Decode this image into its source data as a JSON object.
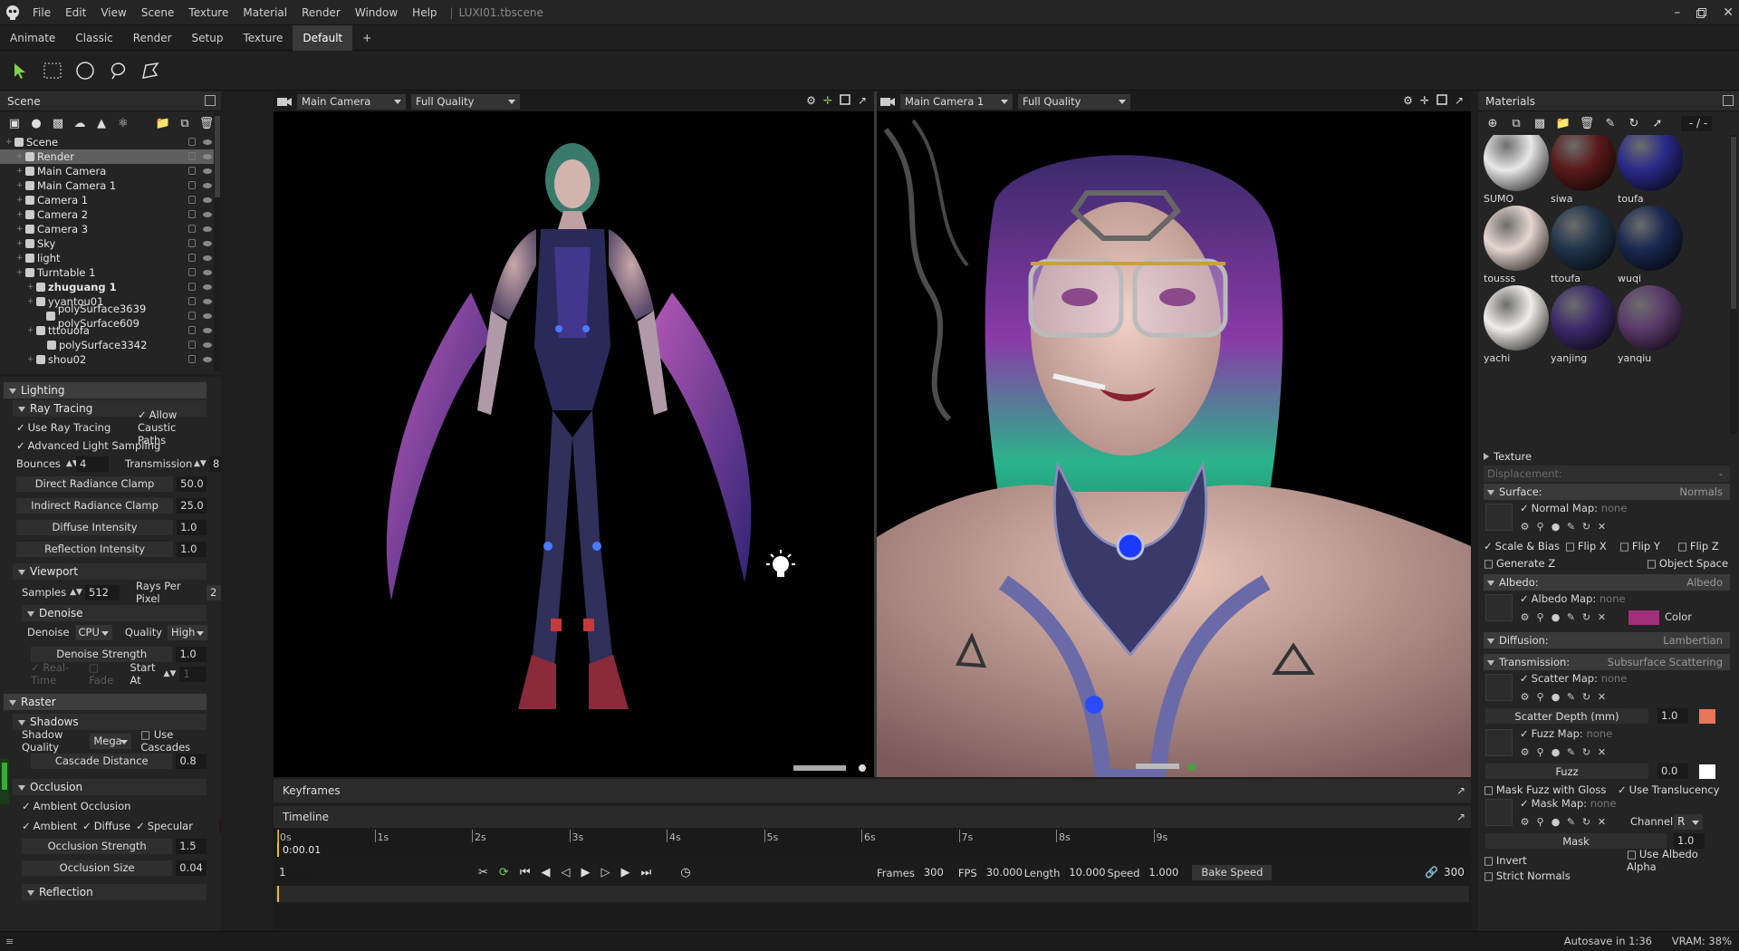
{
  "app": {
    "menu": [
      "File",
      "Edit",
      "View",
      "Scene",
      "Texture",
      "Material",
      "Render",
      "Window",
      "Help"
    ],
    "filename": "LUXI01.tbscene"
  },
  "workspace_tabs": [
    "Animate",
    "Classic",
    "Render",
    "Setup",
    "Texture",
    "Default",
    "+"
  ],
  "active_workspace": "Default",
  "scene": {
    "title": "Scene",
    "tree": [
      {
        "label": "Scene",
        "indent": 0
      },
      {
        "label": "Render",
        "indent": 1,
        "selected": true
      },
      {
        "label": "Main Camera",
        "indent": 1
      },
      {
        "label": "Main Camera 1",
        "indent": 1
      },
      {
        "label": "Camera 1",
        "indent": 1
      },
      {
        "label": "Camera 2",
        "indent": 1
      },
      {
        "label": "Camera 3",
        "indent": 1
      },
      {
        "label": "Sky",
        "indent": 1
      },
      {
        "label": "light",
        "indent": 1
      },
      {
        "label": "Turntable 1",
        "indent": 1
      },
      {
        "label": "zhuguang 1",
        "indent": 2,
        "bold": true
      },
      {
        "label": "yyantou01",
        "indent": 2
      },
      {
        "label": "polySurface3639 polySurface609",
        "indent": 3
      },
      {
        "label": "tttouofa",
        "indent": 2
      },
      {
        "label": "polySurface3342",
        "indent": 3
      },
      {
        "label": "shou02",
        "indent": 2
      }
    ]
  },
  "props": {
    "lighting": "Lighting",
    "ray_tracing": "Ray Tracing",
    "use_ray_tracing": "Use Ray Tracing",
    "allow_caustic": "Allow Caustic Paths",
    "adv_light": "Advanced Light Sampling",
    "bounces_label": "Bounces",
    "bounces": "4",
    "transmission_label": "Transmission",
    "transmission": "8",
    "direct_clamp": "Direct Radiance Clamp",
    "direct_clamp_val": "50.0",
    "indirect_clamp": "Indirect Radiance Clamp",
    "indirect_clamp_val": "25.0",
    "diffuse_int": "Diffuse Intensity",
    "diffuse_int_val": "1.0",
    "reflection_int": "Reflection Intensity",
    "reflection_int_val": "1.0",
    "viewport": "Viewport",
    "samples_label": "Samples",
    "samples": "512",
    "rays_label": "Rays Per Pixel",
    "rays": "2",
    "denoise_sec": "Denoise",
    "denoise_label": "Denoise",
    "denoise_dev": "CPU",
    "quality_label": "Quality",
    "quality": "High",
    "denoise_strength": "Denoise Strength",
    "denoise_strength_val": "1.0",
    "realtime": "Real-Time",
    "fade": "Fade",
    "start_at": "Start At",
    "start_at_val": "1",
    "raster": "Raster",
    "shadows": "Shadows",
    "shadow_quality_label": "Shadow Quality",
    "shadow_quality": "Mega",
    "use_cascades": "Use Cascades",
    "cascade_distance": "Cascade Distance",
    "cascade_distance_val": "0.8",
    "occlusion": "Occlusion",
    "ambient_occlusion": "Ambient Occlusion",
    "ambient": "Ambient",
    "diffuse": "Diffuse",
    "specular": "Specular",
    "occ_strength": "Occlusion Strength",
    "occ_strength_val": "1.5",
    "occ_size": "Occlusion Size",
    "occ_size_val": "0.04",
    "reflection_cut": "Reflection"
  },
  "viewports": [
    {
      "camera": "Main Camera",
      "quality": "Full Quality"
    },
    {
      "camera": "Main Camera 1",
      "quality": "Full Quality"
    }
  ],
  "keyframes": {
    "title": "Keyframes"
  },
  "timeline": {
    "title": "Timeline",
    "ticks": [
      "0s",
      "1s",
      "2s",
      "3s",
      "4s",
      "5s",
      "6s",
      "7s",
      "8s",
      "9s"
    ],
    "current_time": "0:00.01",
    "frame": "1",
    "frames_label": "Frames",
    "frames": "300",
    "fps_label": "FPS",
    "fps": "30.000",
    "length_label": "Length",
    "length": "10.000",
    "speed_label": "Speed",
    "speed": "1.000",
    "bake_speed": "Bake Speed",
    "end_frame": "300"
  },
  "materials": {
    "title": "Materials",
    "page": "- / -",
    "items": [
      {
        "name": "SUMO",
        "color": "#e8e8e8"
      },
      {
        "name": "siwa",
        "color": "#5a1a1a"
      },
      {
        "name": "toufa",
        "color": "#2a2a8a"
      },
      {
        "name": "tousss",
        "color": "#e6d6d0"
      },
      {
        "name": "ttoufa",
        "color": "#20344a"
      },
      {
        "name": "wuqi",
        "color": "#1a2850"
      },
      {
        "name": "yachi",
        "color": "#f0eeea"
      },
      {
        "name": "yanjing",
        "color": "#3a2a6a"
      },
      {
        "name": "yanqiu",
        "color": "#5a3a6a"
      }
    ],
    "texture": "Texture",
    "displacement": "Displacement:",
    "displacement_val": "-",
    "surface": "Surface:",
    "surface_val": "Normals",
    "normal_map": "Normal Map:",
    "none": "none",
    "scale_bias": "Scale & Bias",
    "flip_x": "Flip X",
    "flip_y": "Flip Y",
    "flip_z": "Flip Z",
    "generate_z": "Generate Z",
    "object_space": "Object Space",
    "albedo": "Albedo:",
    "albedo_val": "Albedo",
    "albedo_map": "Albedo Map:",
    "color_label": "Color",
    "albedo_color": "#a0307a",
    "diffusion": "Diffusion:",
    "diffusion_val": "Lambertian",
    "transmission": "Transmission:",
    "transmission_val": "Subsurface Scattering",
    "scatter_map": "Scatter Map:",
    "scatter_depth": "Scatter Depth (mm)",
    "scatter_depth_val": "1.0",
    "scatter_color": "#e8775a",
    "fuzz_map": "Fuzz Map:",
    "fuzz": "Fuzz",
    "fuzz_val": "0.0",
    "fuzz_color": "#ffffff",
    "mask_fuzz": "Mask Fuzz with Gloss",
    "use_translucency": "Use Translucency",
    "mask_map": "Mask Map:",
    "channel": "Channel",
    "channel_val": "R",
    "mask": "Mask",
    "mask_val": "1.0",
    "invert": "Invert",
    "use_albedo_alpha": "Use Albedo Alpha",
    "strict_normals": "Strict Normals"
  },
  "status": {
    "autosave": "Autosave in 1:36",
    "vram": "VRAM: 38%"
  }
}
